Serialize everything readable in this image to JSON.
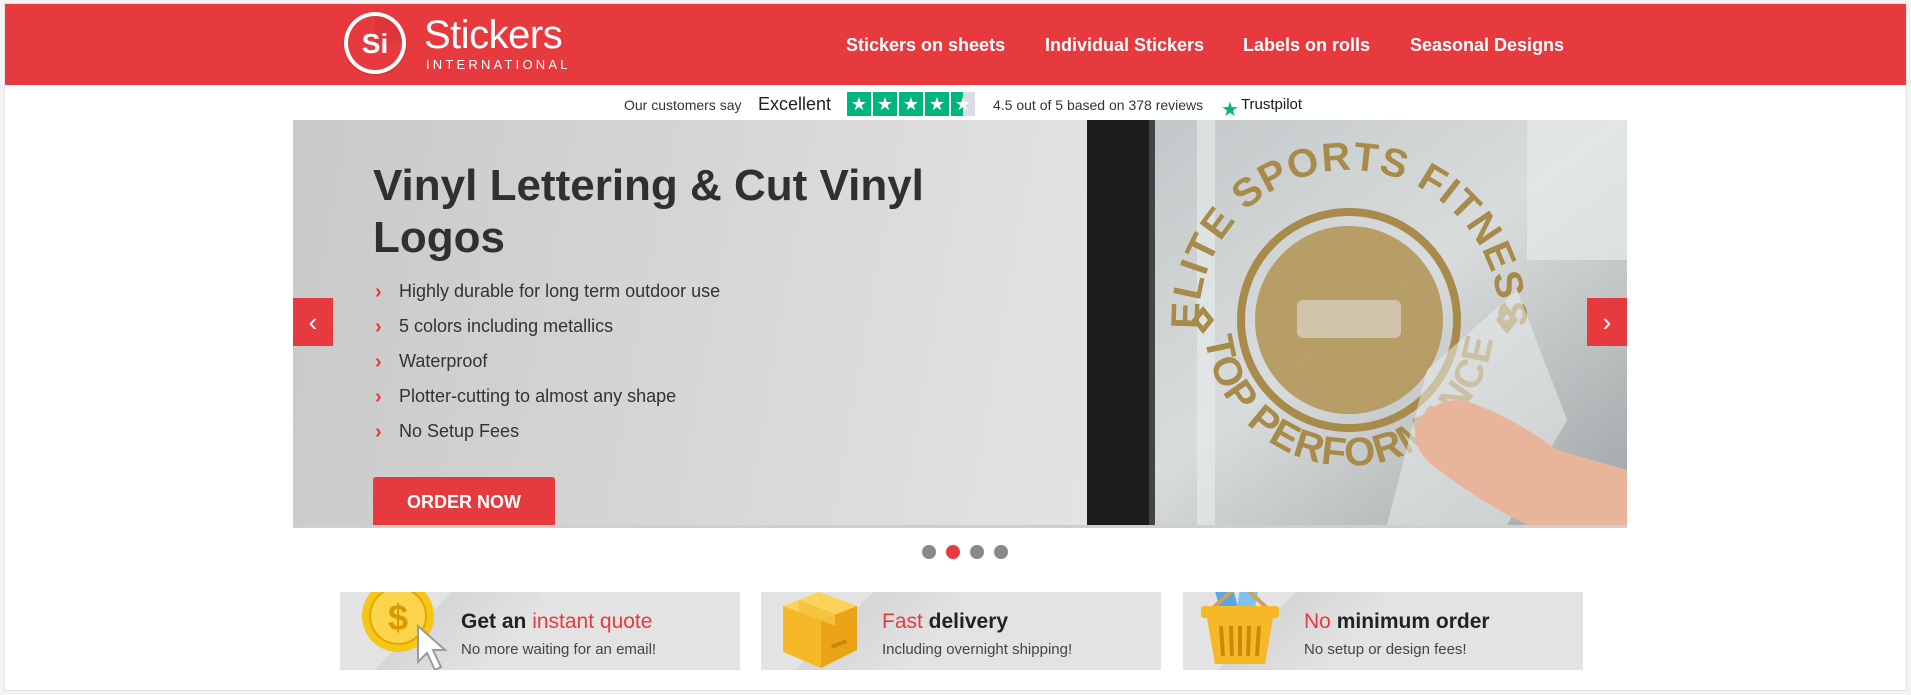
{
  "brand": {
    "initials": "Si",
    "name": "Stickers",
    "sub": "INTERNATIONAL"
  },
  "nav": [
    {
      "label": "Stickers on sheets"
    },
    {
      "label": "Individual Stickers"
    },
    {
      "label": "Labels on rolls"
    },
    {
      "label": "Seasonal Designs"
    }
  ],
  "trustpilot": {
    "intro": "Our customers say",
    "rating_word": "Excellent",
    "rating_value": 4.5,
    "summary": "4.5 out of 5 based on 378 reviews",
    "brand": "Trustpilot"
  },
  "slider": {
    "title": "Vinyl Lettering & Cut Vinyl Logos",
    "features": [
      "Highly durable for long term outdoor use",
      "5 colors including metallics",
      "Waterproof",
      "Plotter-cutting to almost any shape",
      "No Setup Fees"
    ],
    "cta": "ORDER NOW",
    "photo_text_top": "ELITE SPORTS FITNESS",
    "photo_text_bottom": "TOP PERFORMANCE",
    "slide_count": 4,
    "active_slide": 2
  },
  "cards": [
    {
      "pre": "Get an ",
      "highlight": "instant quote",
      "post": "",
      "sub": "No more waiting for an email!",
      "icon": "coin-cursor-icon"
    },
    {
      "pre": "",
      "highlight": "Fast",
      "post": " delivery",
      "sub": "Including overnight shipping!",
      "icon": "package-icon"
    },
    {
      "pre": "",
      "highlight": "No",
      "post": " minimum order",
      "sub": "No setup or design fees!",
      "icon": "basket-icon"
    }
  ],
  "colors": {
    "brand_red": "#e63a3f",
    "trustpilot_green": "#00b67a",
    "coin_gold": "#f5c518",
    "box_yellow": "#f6b826"
  }
}
